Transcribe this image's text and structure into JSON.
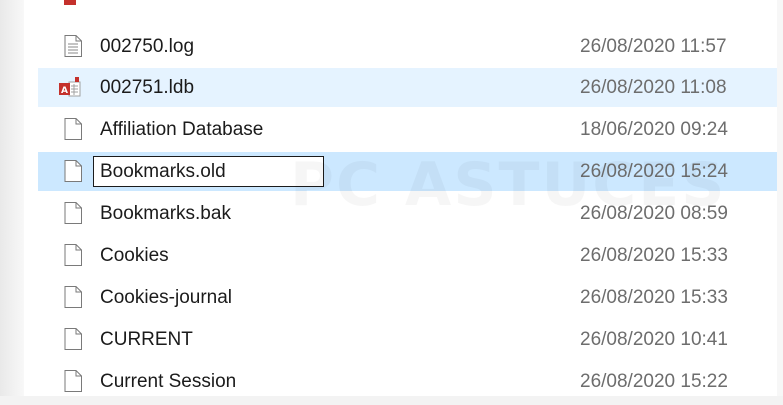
{
  "files": [
    {
      "name": "002750.log",
      "date": "26/08/2020 11:57",
      "icon": "text-file-icon"
    },
    {
      "name": "002751.ldb",
      "date": "26/08/2020 11:08",
      "icon": "access-db-icon"
    },
    {
      "name": "Affiliation Database",
      "date": "18/06/2020 09:24",
      "icon": "blank-file-icon"
    },
    {
      "name": "Bookmarks.old",
      "date": "26/08/2020 15:24",
      "icon": "blank-file-icon"
    },
    {
      "name": "Bookmarks.bak",
      "date": "26/08/2020 08:59",
      "icon": "blank-file-icon"
    },
    {
      "name": "Cookies",
      "date": "26/08/2020 15:33",
      "icon": "blank-file-icon"
    },
    {
      "name": "Cookies-journal",
      "date": "26/08/2020 15:33",
      "icon": "blank-file-icon"
    },
    {
      "name": "CURRENT",
      "date": "26/08/2020 10:41",
      "icon": "blank-file-icon"
    },
    {
      "name": "Current Session",
      "date": "26/08/2020 15:22",
      "icon": "blank-file-icon"
    }
  ],
  "rename": {
    "value": "Bookmarks.old"
  },
  "watermark": {
    "text": "PC ASTUCES"
  },
  "colors": {
    "hover": "#e5f3ff",
    "selected": "#cce8ff",
    "date_text": "#6d6d6d",
    "name_text": "#1b1b1b",
    "access_red": "#c4312c"
  }
}
